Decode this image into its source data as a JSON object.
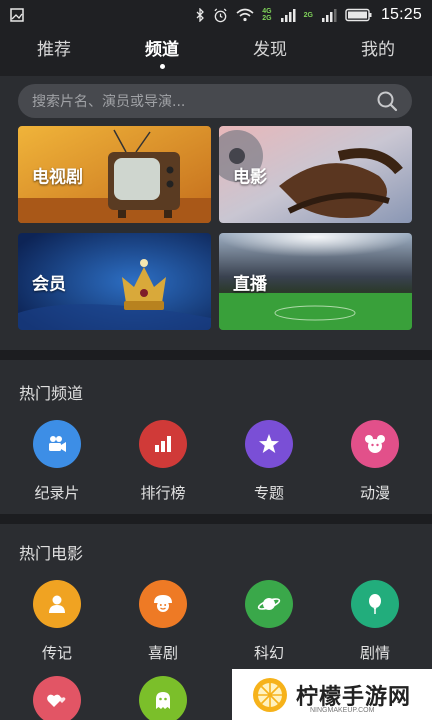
{
  "status": {
    "time": "15:25",
    "net_top": "4G",
    "net_bottom": "2G",
    "net2": "2G"
  },
  "nav": {
    "tabs": [
      {
        "label": "推荐"
      },
      {
        "label": "频道"
      },
      {
        "label": "发现"
      },
      {
        "label": "我的"
      }
    ],
    "active_index": 1
  },
  "search": {
    "placeholder": "搜索片名、演员或导演..."
  },
  "banners": [
    {
      "label": "电视剧"
    },
    {
      "label": "电影"
    },
    {
      "label": "会员"
    },
    {
      "label": "直播"
    }
  ],
  "hot_channels": {
    "title": "热门频道",
    "items": [
      {
        "label": "纪录片",
        "icon": "camera-icon",
        "color": "#3d8ee6"
      },
      {
        "label": "排行榜",
        "icon": "bar-chart-icon",
        "color": "#d03a38"
      },
      {
        "label": "专题",
        "icon": "star-icon",
        "color": "#7a4fd6"
      },
      {
        "label": "动漫",
        "icon": "mouse-head-icon",
        "color": "#e2508a"
      }
    ]
  },
  "hot_movies": {
    "title": "热门电影",
    "items": [
      {
        "label": "传记",
        "icon": "person-icon",
        "color": "#f0a322"
      },
      {
        "label": "喜剧",
        "icon": "smile-face-icon",
        "color": "#ee7a25"
      },
      {
        "label": "科幻",
        "icon": "planet-icon",
        "color": "#3aa84a"
      },
      {
        "label": "剧情",
        "icon": "balloon-icon",
        "color": "#22ad7c"
      },
      {
        "label": "",
        "icon": "hearts-icon",
        "color": "#e25565"
      },
      {
        "label": "",
        "icon": "ghost-icon",
        "color": "#7bbf2a"
      }
    ]
  },
  "watermark": {
    "text": "柠檬手游网",
    "sub": "NINGMAKEUP.COM"
  }
}
